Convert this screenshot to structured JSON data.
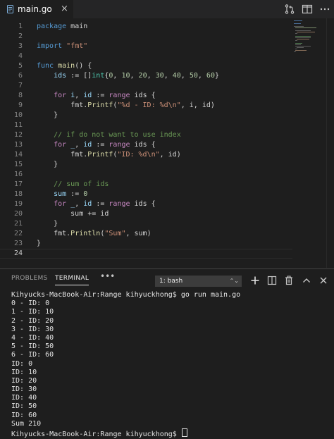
{
  "tab": {
    "filename": "main.go",
    "close": "×"
  },
  "icons": {
    "tab": "go-file-icon",
    "actions": [
      "open-changes-icon",
      "split-editor-icon",
      "more-actions-icon"
    ],
    "panel": [
      "new-terminal-icon",
      "split-terminal-icon",
      "kill-terminal-icon",
      "maximize-panel-icon",
      "close-panel-icon"
    ]
  },
  "editor": {
    "current_line": 24,
    "lines": [
      {
        "n": "1",
        "segs": [
          [
            "kw",
            "package"
          ],
          [
            "plain",
            " main"
          ]
        ]
      },
      {
        "n": "2",
        "segs": []
      },
      {
        "n": "3",
        "segs": [
          [
            "kw",
            "import"
          ],
          [
            "plain",
            " "
          ],
          [
            "str",
            "\"fmt\""
          ]
        ]
      },
      {
        "n": "4",
        "segs": []
      },
      {
        "n": "5",
        "segs": [
          [
            "kw",
            "func"
          ],
          [
            "plain",
            " "
          ],
          [
            "fn",
            "main"
          ],
          [
            "plain",
            "() {"
          ]
        ]
      },
      {
        "n": "6",
        "segs": [
          [
            "plain",
            "    "
          ],
          [
            "var",
            "ids"
          ],
          [
            "plain",
            " := []"
          ],
          [
            "typ",
            "int"
          ],
          [
            "plain",
            "{"
          ],
          [
            "num",
            "0"
          ],
          [
            "plain",
            ", "
          ],
          [
            "num",
            "10"
          ],
          [
            "plain",
            ", "
          ],
          [
            "num",
            "20"
          ],
          [
            "plain",
            ", "
          ],
          [
            "num",
            "30"
          ],
          [
            "plain",
            ", "
          ],
          [
            "num",
            "40"
          ],
          [
            "plain",
            ", "
          ],
          [
            "num",
            "50"
          ],
          [
            "plain",
            ", "
          ],
          [
            "num",
            "60"
          ],
          [
            "plain",
            "}"
          ]
        ]
      },
      {
        "n": "7",
        "segs": []
      },
      {
        "n": "8",
        "segs": [
          [
            "plain",
            "    "
          ],
          [
            "kw2",
            "for"
          ],
          [
            "plain",
            " "
          ],
          [
            "var",
            "i"
          ],
          [
            "plain",
            ", "
          ],
          [
            "var",
            "id"
          ],
          [
            "plain",
            " := "
          ],
          [
            "kw2",
            "range"
          ],
          [
            "plain",
            " ids {"
          ]
        ]
      },
      {
        "n": "9",
        "segs": [
          [
            "plain",
            "        fmt."
          ],
          [
            "fn",
            "Printf"
          ],
          [
            "plain",
            "("
          ],
          [
            "str",
            "\"%d - ID: %d\\n\""
          ],
          [
            "plain",
            ", i, id)"
          ]
        ]
      },
      {
        "n": "10",
        "segs": [
          [
            "plain",
            "    }"
          ]
        ]
      },
      {
        "n": "11",
        "segs": []
      },
      {
        "n": "12",
        "segs": [
          [
            "plain",
            "    "
          ],
          [
            "cmt",
            "// if do not want to use index"
          ]
        ]
      },
      {
        "n": "13",
        "segs": [
          [
            "plain",
            "    "
          ],
          [
            "kw2",
            "for"
          ],
          [
            "plain",
            " "
          ],
          [
            "var",
            "_"
          ],
          [
            "plain",
            ", "
          ],
          [
            "var",
            "id"
          ],
          [
            "plain",
            " := "
          ],
          [
            "kw2",
            "range"
          ],
          [
            "plain",
            " ids {"
          ]
        ]
      },
      {
        "n": "14",
        "segs": [
          [
            "plain",
            "        fmt."
          ],
          [
            "fn",
            "Printf"
          ],
          [
            "plain",
            "("
          ],
          [
            "str",
            "\"ID: %d\\n\""
          ],
          [
            "plain",
            ", id)"
          ]
        ]
      },
      {
        "n": "15",
        "segs": [
          [
            "plain",
            "    }"
          ]
        ]
      },
      {
        "n": "16",
        "segs": []
      },
      {
        "n": "17",
        "segs": [
          [
            "plain",
            "    "
          ],
          [
            "cmt",
            "// sum of ids"
          ]
        ]
      },
      {
        "n": "18",
        "segs": [
          [
            "plain",
            "    "
          ],
          [
            "var",
            "sum"
          ],
          [
            "plain",
            " := "
          ],
          [
            "num",
            "0"
          ]
        ]
      },
      {
        "n": "19",
        "segs": [
          [
            "plain",
            "    "
          ],
          [
            "kw2",
            "for"
          ],
          [
            "plain",
            " "
          ],
          [
            "var",
            "_"
          ],
          [
            "plain",
            ", "
          ],
          [
            "var",
            "id"
          ],
          [
            "plain",
            " := "
          ],
          [
            "kw2",
            "range"
          ],
          [
            "plain",
            " ids {"
          ]
        ]
      },
      {
        "n": "20",
        "segs": [
          [
            "plain",
            "        sum += id"
          ]
        ]
      },
      {
        "n": "21",
        "segs": [
          [
            "plain",
            "    }"
          ]
        ]
      },
      {
        "n": "22",
        "segs": [
          [
            "plain",
            "    fmt."
          ],
          [
            "fn",
            "Println"
          ],
          [
            "plain",
            "("
          ],
          [
            "str",
            "\"Sum\""
          ],
          [
            "plain",
            ", sum)"
          ]
        ]
      },
      {
        "n": "23",
        "segs": [
          [
            "plain",
            "}"
          ]
        ]
      },
      {
        "n": "24",
        "segs": []
      }
    ]
  },
  "panel": {
    "tabs": {
      "problems": "PROBLEMS",
      "terminal": "TERMINAL",
      "more": "•••"
    },
    "shell": {
      "selected": "1: bash",
      "arrow": "⌃⌄"
    },
    "terminal_lines": [
      "Kihyucks-MacBook-Air:Range kihyuckhong$ go run main.go",
      "0 - ID: 0",
      "1 - ID: 10",
      "2 - ID: 20",
      "3 - ID: 30",
      "4 - ID: 40",
      "5 - ID: 50",
      "6 - ID: 60",
      "ID: 0",
      "ID: 10",
      "ID: 20",
      "ID: 30",
      "ID: 40",
      "ID: 50",
      "ID: 60",
      "Sum 210",
      "Kihyucks-MacBook-Air:Range kihyuckhong$ "
    ]
  },
  "colors": {
    "editor_bg": "#1e1e1e",
    "keyword": "#569cd6",
    "control": "#c586c0",
    "string": "#ce9178",
    "number": "#b5cea8",
    "comment": "#6a9955",
    "function": "#dcdcaa",
    "variable": "#9cdcfe",
    "type": "#4ec9b0"
  }
}
